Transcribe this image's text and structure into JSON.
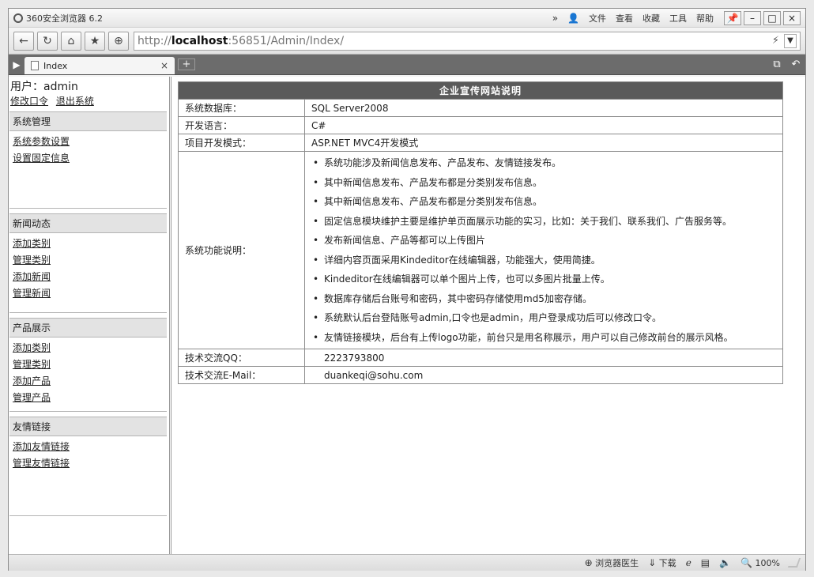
{
  "window": {
    "title": "360安全浏览器 6.2",
    "menu": [
      "文件",
      "查看",
      "收藏",
      "工具",
      "帮助"
    ],
    "menu_glyphs": {
      "chevrons": "»",
      "user": "👤"
    },
    "controls": {
      "pin": "📌",
      "minimize": "–",
      "maximize": "□",
      "close": "×"
    }
  },
  "nav": {
    "back": "←",
    "refresh": "↻",
    "home": "⌂",
    "star": "★",
    "shield": "⊕",
    "url_prefix": "http://",
    "url_host": "localhost",
    "url_rest": ":56851/Admin/Index/",
    "bolt": "⚡",
    "dropdown": "▼"
  },
  "tabs": {
    "sidebar_toggle": "▶",
    "active_tab": "Index",
    "close": "×",
    "new_tab": "+",
    "right_icons": [
      "⧉",
      "↶"
    ]
  },
  "sidebar": {
    "user_line": "用户：admin",
    "links": [
      "修改口令",
      "退出系统"
    ],
    "groups": [
      {
        "title": "系统管理",
        "items": [
          "系统参数设置",
          "设置固定信息"
        ]
      },
      {
        "title": "新闻动态",
        "items": [
          "添加类别",
          "管理类别",
          "添加新闻",
          "管理新闻"
        ]
      },
      {
        "title": "产品展示",
        "items": [
          "添加类别",
          "管理类别",
          "添加产品",
          "管理产品"
        ]
      },
      {
        "title": "友情链接",
        "items": [
          "添加友情链接",
          "管理友情链接"
        ]
      }
    ]
  },
  "info": {
    "header": "企业宣传网站说明",
    "rows": [
      {
        "label": "系统数据库：",
        "value": "SQL Server2008"
      },
      {
        "label": "开发语言：",
        "value": "C#"
      },
      {
        "label": "项目开发模式：",
        "value": "ASP.NET MVC4开发模式"
      }
    ],
    "features_label": "系统功能说明：",
    "features": [
      "系统功能涉及新闻信息发布、产品发布、友情链接发布。",
      "其中新闻信息发布、产品发布都是分类别发布信息。",
      "其中新闻信息发布、产品发布都是分类别发布信息。",
      "固定信息模块维护主要是维护单页面展示功能的实习，比如：关于我们、联系我们、广告服务等。",
      "发布新闻信息、产品等都可以上传图片",
      "详细内容页面采用Kindeditor在线编辑器，功能强大，使用简捷。",
      "Kindeditor在线编辑器可以单个图片上传，也可以多图片批量上传。",
      "数据库存储后台账号和密码，其中密码存储使用md5加密存储。",
      "系统默认后台登陆账号admin,口令也是admin，用户登录成功后可以修改口令。",
      "友情链接模块，后台有上传logo功能，前台只是用名称展示，用户可以自己修改前台的展示风格。"
    ],
    "contact_rows": [
      {
        "label": "技术交流QQ：",
        "value": "2223793800"
      },
      {
        "label": "技术交流E-Mail：",
        "value": "duankeqi@sohu.com"
      }
    ]
  },
  "status": {
    "doctor": "浏览器医生",
    "download": "下载",
    "zoom": "100%",
    "icons": {
      "doctor": "⊕",
      "download": "⇓",
      "ie": "ℯ",
      "window": "▤",
      "sound": "🔈",
      "zoom": "🔍"
    }
  }
}
